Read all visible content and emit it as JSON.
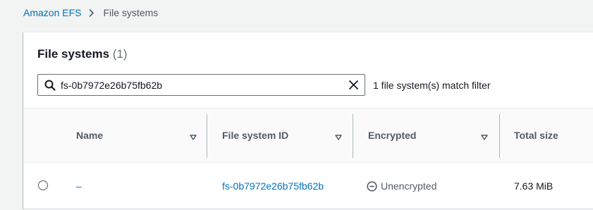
{
  "breadcrumb": {
    "parent": "Amazon EFS",
    "current": "File systems"
  },
  "panel": {
    "title": "File systems",
    "count": "(1)"
  },
  "search": {
    "value": "fs-0b7972e26b75fb62b",
    "match_text": "1 file system(s) match filter"
  },
  "table": {
    "columns": [
      "Name",
      "File system ID",
      "Encrypted",
      "Total size"
    ],
    "rows": [
      {
        "name": "–",
        "file_system_id": "fs-0b7972e26b75fb62b",
        "encrypted": "Unencrypted",
        "total_size": "7.63 MiB"
      }
    ]
  },
  "icons": {
    "breadcrumb_separator": "chevron-right-icon",
    "search": "search-icon",
    "clear": "close-icon",
    "sort": "caret-down-icon",
    "unencrypted": "minus-circle-icon"
  },
  "colors": {
    "link": "#0073bb",
    "background": "#f2f3f3",
    "text": "#16191f"
  }
}
